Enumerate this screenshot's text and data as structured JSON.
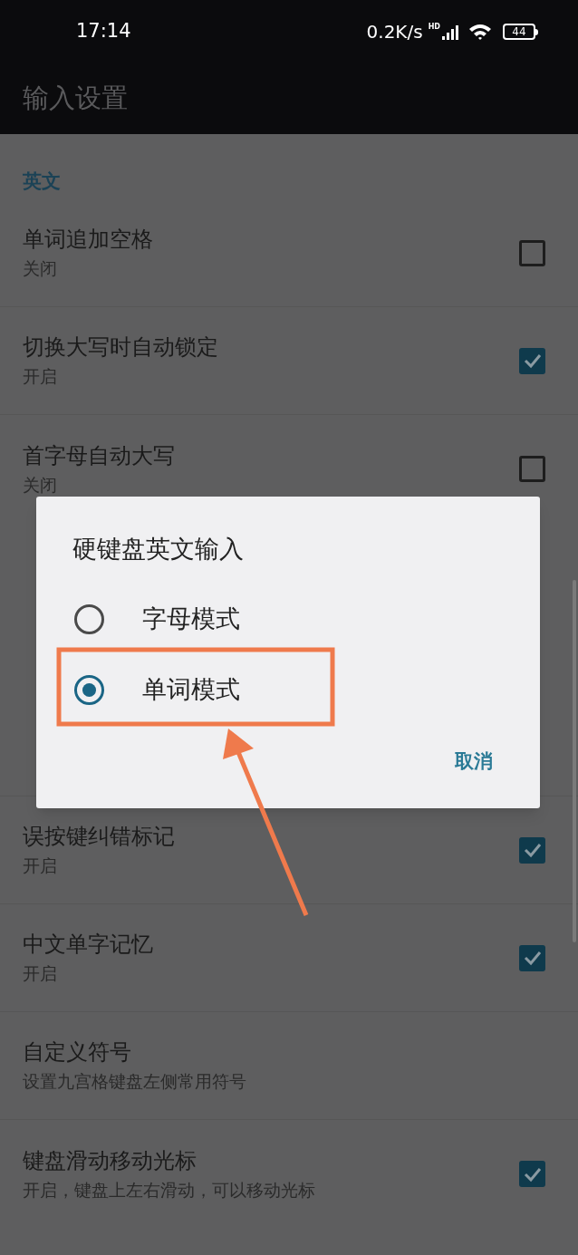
{
  "status_bar": {
    "time": "17:14",
    "net_speed": "0.2K/s",
    "signal_badge": "HD",
    "battery": "44"
  },
  "app_bar": {
    "title": "输入设置"
  },
  "sections": [
    {
      "header": "英文",
      "items": [
        {
          "title": "单词追加空格",
          "summary": "关闭",
          "kind": "checkbox",
          "checked": false
        },
        {
          "title": "切换大写时自动锁定",
          "summary": "开启",
          "kind": "checkbox",
          "checked": true
        },
        {
          "title": "首字母自动大写",
          "summary": "关闭",
          "kind": "checkbox",
          "checked": false
        }
      ]
    },
    {
      "items": [
        {
          "title": "误按键纠错标记",
          "summary": "开启",
          "kind": "checkbox",
          "checked": true
        },
        {
          "title": "中文单字记忆",
          "summary": "开启",
          "kind": "checkbox",
          "checked": true
        },
        {
          "title": "自定义符号",
          "summary": "设置九宫格键盘左侧常用符号",
          "kind": "plain"
        },
        {
          "title": "键盘滑动移动光标",
          "summary": "开启，键盘上左右滑动，可以移动光标",
          "kind": "checkbox",
          "checked": true
        }
      ]
    }
  ],
  "dialog": {
    "title": "硬键盘英文输入",
    "options": [
      {
        "label": "字母模式",
        "selected": false
      },
      {
        "label": "单词模式",
        "selected": true
      }
    ],
    "cancel": "取消"
  }
}
